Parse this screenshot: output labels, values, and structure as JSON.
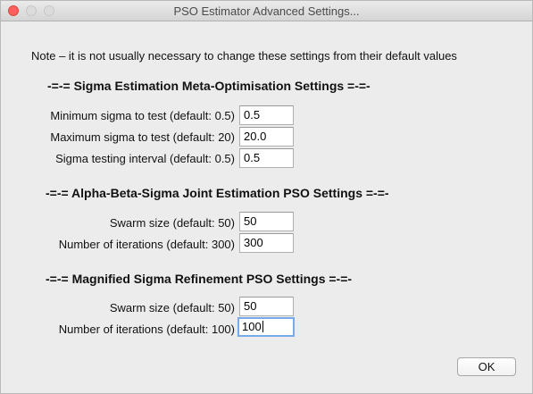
{
  "window": {
    "title": "PSO Estimator Advanced Settings..."
  },
  "note": "Note – it is not usually necessary to change these settings from their default values",
  "sections": [
    {
      "heading": "-=-= Sigma Estimation Meta-Optimisation Settings =-=-",
      "fields": [
        {
          "label": "Minimum sigma to test (default: 0.5)",
          "value": "0.5"
        },
        {
          "label": "Maximum sigma to test (default: 20)",
          "value": "20.0"
        },
        {
          "label": "Sigma testing interval (default: 0.5)",
          "value": "0.5"
        }
      ]
    },
    {
      "heading": "-=-= Alpha-Beta-Sigma Joint Estimation PSO Settings =-=-",
      "fields": [
        {
          "label": "Swarm size (default: 50)",
          "value": "50"
        },
        {
          "label": "Number of iterations (default: 300)",
          "value": "300"
        }
      ]
    },
    {
      "heading": "-=-= Magnified Sigma Refinement PSO Settings =-=-",
      "fields": [
        {
          "label": "Swarm size (default: 50)",
          "value": "50"
        },
        {
          "label": "Number of iterations (default: 100)",
          "value": "100"
        }
      ]
    }
  ],
  "buttons": {
    "ok": "OK"
  }
}
